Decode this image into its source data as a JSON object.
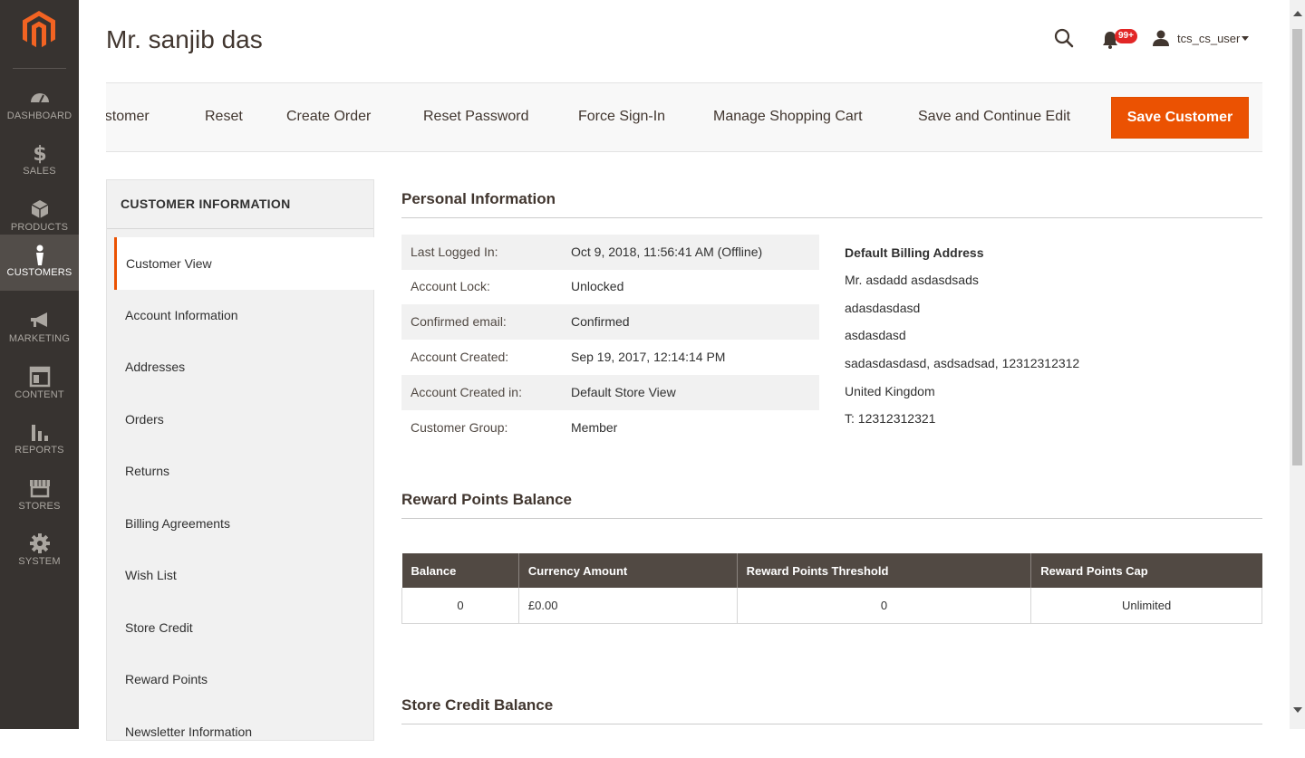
{
  "sidebar": {
    "logo": "magento-logo",
    "items": [
      {
        "label": "DASHBOARD",
        "icon": "speedometer-icon"
      },
      {
        "label": "SALES",
        "icon": "dollar-icon"
      },
      {
        "label": "PRODUCTS",
        "icon": "box-icon"
      },
      {
        "label": "CUSTOMERS",
        "icon": "person-icon",
        "active": true
      },
      {
        "label": "MARKETING",
        "icon": "megaphone-icon"
      },
      {
        "label": "CONTENT",
        "icon": "layout-icon"
      },
      {
        "label": "REPORTS",
        "icon": "bar-chart-icon"
      },
      {
        "label": "STORES",
        "icon": "storefront-icon"
      },
      {
        "label": "SYSTEM",
        "icon": "gear-icon"
      }
    ]
  },
  "header": {
    "title": "Mr. sanjib das",
    "notifications_badge": "99+",
    "username": "tcs_cs_user"
  },
  "toolbar": {
    "buttons": [
      "e Customer",
      "Reset",
      "Create Order",
      "Reset Password",
      "Force Sign-In",
      "Manage Shopping Cart",
      "Save and Continue Edit"
    ],
    "primary": "Save Customer"
  },
  "tabs": {
    "title": "CUSTOMER INFORMATION",
    "items": [
      "Customer View",
      "Account Information",
      "Addresses",
      "Orders",
      "Returns",
      "Billing Agreements",
      "Wish List",
      "Store Credit",
      "Reward Points",
      "Newsletter Information"
    ]
  },
  "personal": {
    "title": "Personal Information",
    "rows": [
      {
        "k": "Last Logged In:",
        "v": "Oct 9, 2018, 11:56:41 AM (Offline)"
      },
      {
        "k": "Account Lock:",
        "v": "Unlocked"
      },
      {
        "k": "Confirmed email:",
        "v": "Confirmed"
      },
      {
        "k": "Account Created:",
        "v": "Sep 19, 2017, 12:14:14 PM"
      },
      {
        "k": "Account Created in:",
        "v": "Default Store View"
      },
      {
        "k": "Customer Group:",
        "v": "Member"
      }
    ]
  },
  "billing": {
    "title": "Default Billing Address",
    "lines": [
      "Mr. asdadd asdasdsads",
      "adasdasdasd",
      "asdasdasd",
      "sadasdasdasd, asdsadsad, 12312312312",
      "United Kingdom",
      "T: 12312312321"
    ]
  },
  "reward": {
    "title": "Reward Points Balance",
    "headers": [
      "Balance",
      "Currency Amount",
      "Reward Points Threshold",
      "Reward Points Cap"
    ],
    "row": [
      "0",
      "£0.00",
      "0",
      "Unlimited"
    ]
  },
  "store_credit": {
    "title": "Store Credit Balance"
  },
  "colors": {
    "sidebar_bg": "#373330",
    "accent": "#eb5202",
    "table_header": "#514943"
  }
}
